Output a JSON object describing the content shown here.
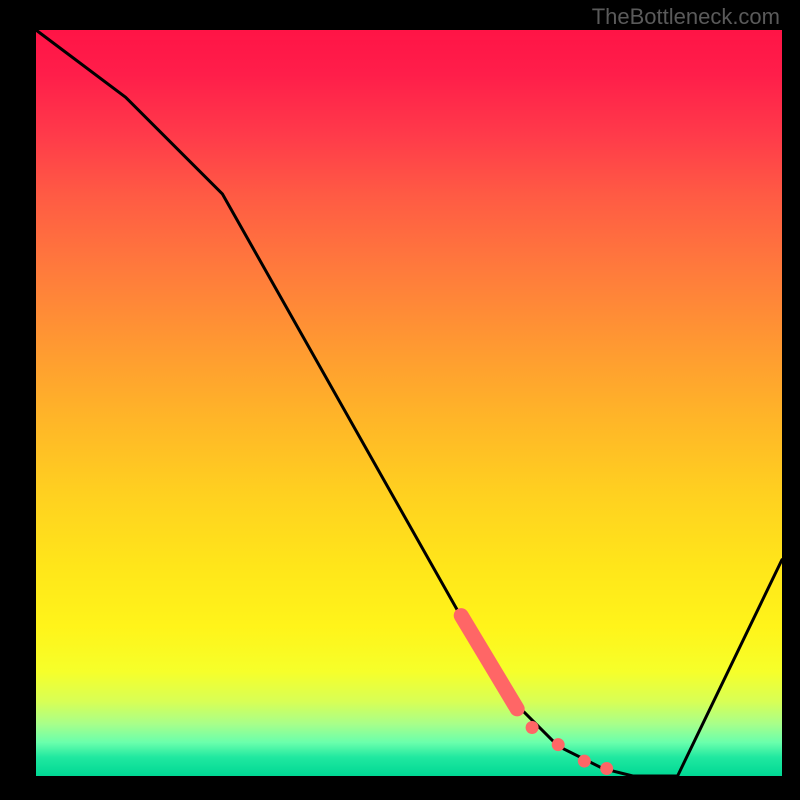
{
  "watermark": "TheBottleneck.com",
  "chart_data": {
    "type": "line",
    "title": "",
    "xlabel": "",
    "ylabel": "",
    "xlim": [
      0,
      100
    ],
    "ylim": [
      0,
      100
    ],
    "grid": false,
    "legend": false,
    "background": "rainbow-gradient-red-to-green",
    "series": [
      {
        "name": "main-curve",
        "color": "#000000",
        "x": [
          0,
          12,
          20,
          25,
          60,
          64,
          70,
          76,
          80,
          86,
          100
        ],
        "values": [
          100,
          91,
          83,
          78,
          16,
          10,
          4,
          1,
          0,
          0,
          29
        ]
      },
      {
        "name": "highlight-segment",
        "color": "#ff6666",
        "style": "thick",
        "x": [
          57,
          64.5
        ],
        "values": [
          21.5,
          9.0
        ]
      },
      {
        "name": "highlight-dots",
        "color": "#ff6666",
        "style": "dots",
        "x": [
          66.5,
          70,
          73.5,
          76.5
        ],
        "values": [
          6.5,
          4.2,
          2.0,
          1.0
        ]
      }
    ]
  }
}
